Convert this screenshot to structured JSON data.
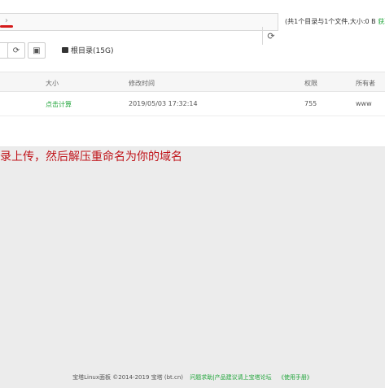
{
  "pathbar": {
    "arrow_icon": "chevron-right-icon",
    "refresh_icon": "refresh-icon"
  },
  "summary": {
    "text": "(共1个目录与1个文件,大小:0 B",
    "link": "获取"
  },
  "toolbar": {
    "refresh_icon": "refresh-icon",
    "terminal_icon": "terminal-icon",
    "root_dir_label": "根目录(15G)"
  },
  "table": {
    "headers": {
      "size": "大小",
      "modified": "修改时间",
      "permission": "权限",
      "owner": "所有者"
    },
    "rows": [
      {
        "size": "点击计算",
        "modified": "2019/05/03 17:32:14",
        "permission": "755",
        "owner": "www"
      }
    ]
  },
  "annotation": "录上传，然后解压重命名为你的域名",
  "footer": {
    "copyright": "宝塔Linux面板 ©2014-2019 宝塔 (bt.cn)",
    "feedback_link": "问题求助|产品建议请上宝塔论坛",
    "manual_link": "《使用手册》"
  },
  "colors": {
    "accent_green": "#20a53a",
    "annotation_red": "#c0141a"
  }
}
